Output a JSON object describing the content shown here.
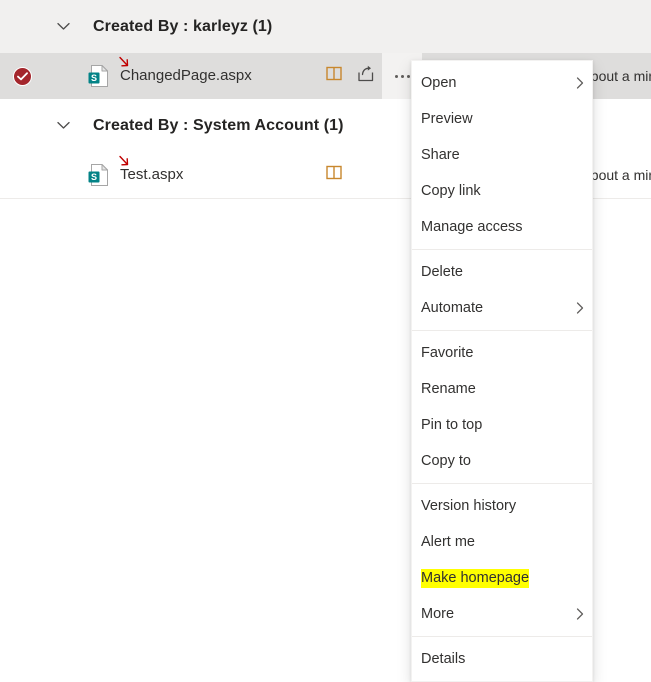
{
  "file_list": {
    "groups": [
      {
        "chevron_icon": "chevron-down-icon",
        "title": "Created By : karleyz (1)",
        "shaded": true,
        "rows": [
          {
            "selected": true,
            "selected_icon": "check-circle-icon",
            "file_icon": "sharepoint-page-icon",
            "annotation_icon": "red-arrow-annotation",
            "name": "ChangedPage.aspx",
            "actions": [
              {
                "icon": "columns-icon",
                "name": "column-toggle-button"
              },
              {
                "icon": "share-icon",
                "name": "share-button"
              },
              {
                "icon": "ellipsis-icon",
                "name": "more-options-button"
              }
            ],
            "modified": "about a minute ago"
          }
        ]
      },
      {
        "chevron_icon": "chevron-down-icon",
        "title": "Created By : System Account (1)",
        "shaded": false,
        "rows": [
          {
            "selected": false,
            "file_icon": "sharepoint-page-icon",
            "annotation_icon": "red-arrow-annotation",
            "name": "Test.aspx",
            "actions": [
              {
                "icon": "columns-icon",
                "name": "column-toggle-button"
              }
            ],
            "modified": "about a minute ago"
          }
        ]
      }
    ]
  },
  "context_menu": {
    "items": [
      {
        "label": "Open",
        "name": "menu-item-open",
        "submenu": true,
        "separator_after": false,
        "highlighted": false
      },
      {
        "label": "Preview",
        "name": "menu-item-preview",
        "submenu": false,
        "separator_after": false,
        "highlighted": false
      },
      {
        "label": "Share",
        "name": "menu-item-share",
        "submenu": false,
        "separator_after": false,
        "highlighted": false
      },
      {
        "label": "Copy link",
        "name": "menu-item-copy-link",
        "submenu": false,
        "separator_after": false,
        "highlighted": false
      },
      {
        "label": "Manage access",
        "name": "menu-item-manage-access",
        "submenu": false,
        "separator_after": true,
        "highlighted": false
      },
      {
        "label": "Delete",
        "name": "menu-item-delete",
        "submenu": false,
        "separator_after": false,
        "highlighted": false
      },
      {
        "label": "Automate",
        "name": "menu-item-automate",
        "submenu": true,
        "separator_after": true,
        "highlighted": false
      },
      {
        "label": "Favorite",
        "name": "menu-item-favorite",
        "submenu": false,
        "separator_after": false,
        "highlighted": false
      },
      {
        "label": "Rename",
        "name": "menu-item-rename",
        "submenu": false,
        "separator_after": false,
        "highlighted": false
      },
      {
        "label": "Pin to top",
        "name": "menu-item-pin-to-top",
        "submenu": false,
        "separator_after": false,
        "highlighted": false
      },
      {
        "label": "Copy to",
        "name": "menu-item-copy-to",
        "submenu": false,
        "separator_after": true,
        "highlighted": false
      },
      {
        "label": "Version history",
        "name": "menu-item-version-history",
        "submenu": false,
        "separator_after": false,
        "highlighted": false
      },
      {
        "label": "Alert me",
        "name": "menu-item-alert-me",
        "submenu": false,
        "separator_after": false,
        "highlighted": false
      },
      {
        "label": "Make homepage",
        "name": "menu-item-make-homepage",
        "submenu": false,
        "separator_after": false,
        "highlighted": true
      },
      {
        "label": "More",
        "name": "menu-item-more",
        "submenu": true,
        "separator_after": true,
        "highlighted": false
      },
      {
        "label": "Details",
        "name": "menu-item-details",
        "submenu": false,
        "separator_after": false,
        "highlighted": false
      }
    ]
  },
  "colors": {
    "selection_red": "#a4262c",
    "sharepoint_teal": "#038387",
    "column_icon_gold": "#c8872d",
    "highlight_yellow": "#ffff00",
    "annotation_red": "#c00000",
    "selected_row_bg": "#dedddc",
    "group_header_bg": "#f1f0ef"
  }
}
